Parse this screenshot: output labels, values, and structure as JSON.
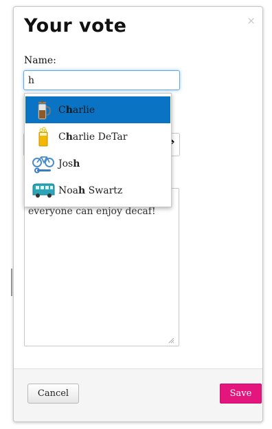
{
  "dialog": {
    "title": "Your vote",
    "close_glyph": "×"
  },
  "form": {
    "name_label": "Name:",
    "name_value": "h",
    "comment_visible": "not everyone drinks it. But everyone can enjoy decaf!"
  },
  "autocomplete": {
    "items": [
      {
        "label_before": "C",
        "label_match": "h",
        "label_after": "arlie",
        "icon": "french-press-icon",
        "active": true
      },
      {
        "label_before": "C",
        "label_match": "h",
        "label_after": "arlie DeTar",
        "icon": "beer-glass-icon",
        "active": false
      },
      {
        "label_before": "Jos",
        "label_match": "h",
        "label_after": "",
        "icon": "bicycle-wrench-icon",
        "active": false
      },
      {
        "label_before": "Noa",
        "label_match": "h",
        "label_after": " Swartz",
        "icon": "bus-icon",
        "active": false
      }
    ]
  },
  "footer": {
    "cancel_label": "Cancel",
    "save_label": "Save"
  },
  "colors": {
    "save_bg": "#e4157d",
    "active_item_bg": "#0a73c4",
    "focus_border": "#62a8e6"
  }
}
